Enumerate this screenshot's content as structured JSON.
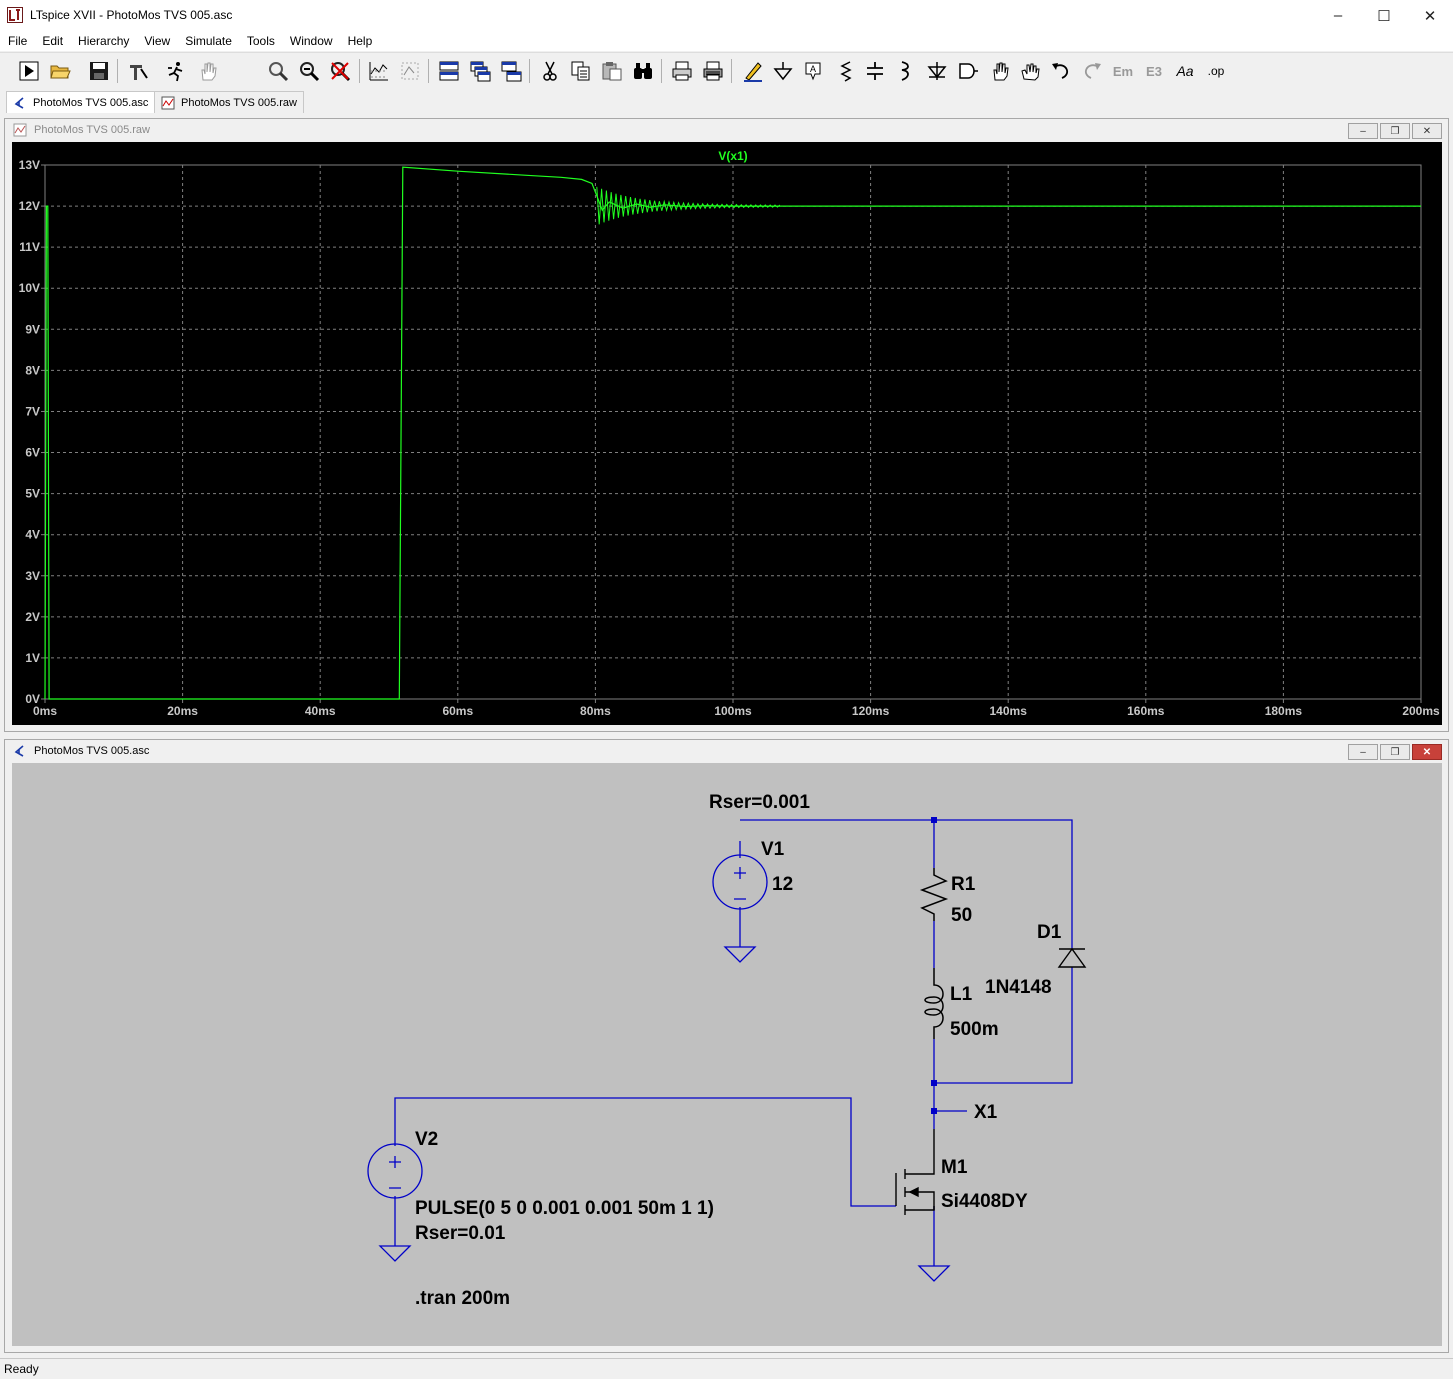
{
  "app": {
    "title": "LTspice XVII - PhotoMos TVS 005.asc"
  },
  "menu": [
    "File",
    "Edit",
    "Hierarchy",
    "View",
    "Simulate",
    "Tools",
    "Window",
    "Help"
  ],
  "toolbar_icons": [
    "run-icon",
    "open-icon",
    "save-icon",
    "control-panel-icon",
    "halt-icon",
    "pan-icon",
    "zoom-in-icon",
    "zoom-out-icon",
    "zoom-cancel-icon",
    "autorange-icon",
    "waveform-icon",
    "tile-horizontal-icon",
    "cascade-icon",
    "tile-vertical-icon",
    "cut-icon",
    "copy-icon",
    "paste-icon",
    "find-icon",
    "print-icon",
    "print-setup-icon",
    "draw-wire-icon",
    "ground-icon",
    "label-net-icon",
    "resistor-icon",
    "capacitor-icon",
    "inductor-icon",
    "diode-icon",
    "component-icon",
    "move-icon",
    "drag-icon",
    "undo-icon",
    "redo-icon",
    "rotate-icon",
    "mirror-icon",
    "text-icon",
    "spice-directive-icon"
  ],
  "tabs": [
    {
      "label": "PhotoMos TVS 005.asc",
      "active": true
    },
    {
      "label": "PhotoMos TVS 005.raw",
      "active": false
    }
  ],
  "plot_window": {
    "title": "PhotoMos TVS 005.raw"
  },
  "schematic_window": {
    "title": "PhotoMos TVS 005.asc",
    "components": {
      "v1_ser": "Rser=0.001",
      "v1_name": "V1",
      "v1_value": "12",
      "r1_name": "R1",
      "r1_value": "50",
      "d1_name": "D1",
      "d1_value": "1N4148",
      "l1_name": "L1",
      "l1_value": "500m",
      "net_label": "X1",
      "v2_name": "V2",
      "v2_value": "PULSE(0 5 0 0.001 0.001 50m 1 1)",
      "v2_ser": "Rser=0.01",
      "m1_name": "M1",
      "m1_value": "Si4408DY",
      "directive": ".tran 200m"
    }
  },
  "status": "Ready",
  "colors": {
    "trace": "#20ff20",
    "wire": "#0000c8",
    "schematic_bg": "#c0c0c0",
    "plot_bg": "#000000",
    "grid": "#808080",
    "axis_text": "#c8c8c8"
  },
  "chart_data": {
    "type": "line",
    "title": "",
    "xlabel": "",
    "ylabel": "",
    "x_ticks": [
      "0ms",
      "20ms",
      "40ms",
      "60ms",
      "80ms",
      "100ms",
      "120ms",
      "140ms",
      "160ms",
      "180ms",
      "200ms"
    ],
    "y_ticks": [
      "0V",
      "1V",
      "2V",
      "3V",
      "4V",
      "5V",
      "6V",
      "7V",
      "8V",
      "9V",
      "10V",
      "11V",
      "12V",
      "13V"
    ],
    "xlim": [
      0,
      200
    ],
    "ylim": [
      0,
      13
    ],
    "x_unit": "ms",
    "y_unit": "V",
    "grid": true,
    "series": [
      {
        "name": "V(x1)",
        "color": "#20ff20",
        "x": [
          0,
          0.2,
          0.4,
          0.6,
          50,
          50.2,
          51.5,
          52,
          60,
          70,
          75,
          78,
          79.5,
          80.2,
          81,
          82,
          84,
          86,
          88,
          90,
          93,
          96,
          100,
          105,
          110,
          140,
          200
        ],
        "y": [
          0,
          12,
          12,
          0,
          0,
          0,
          0,
          12.95,
          12.85,
          12.75,
          12.7,
          12.65,
          12.55,
          12.25,
          11.9,
          12.1,
          11.95,
          12.05,
          11.97,
          12.03,
          11.99,
          12.01,
          12.0,
          12.0,
          12.0,
          12.0,
          12.0
        ]
      }
    ]
  }
}
